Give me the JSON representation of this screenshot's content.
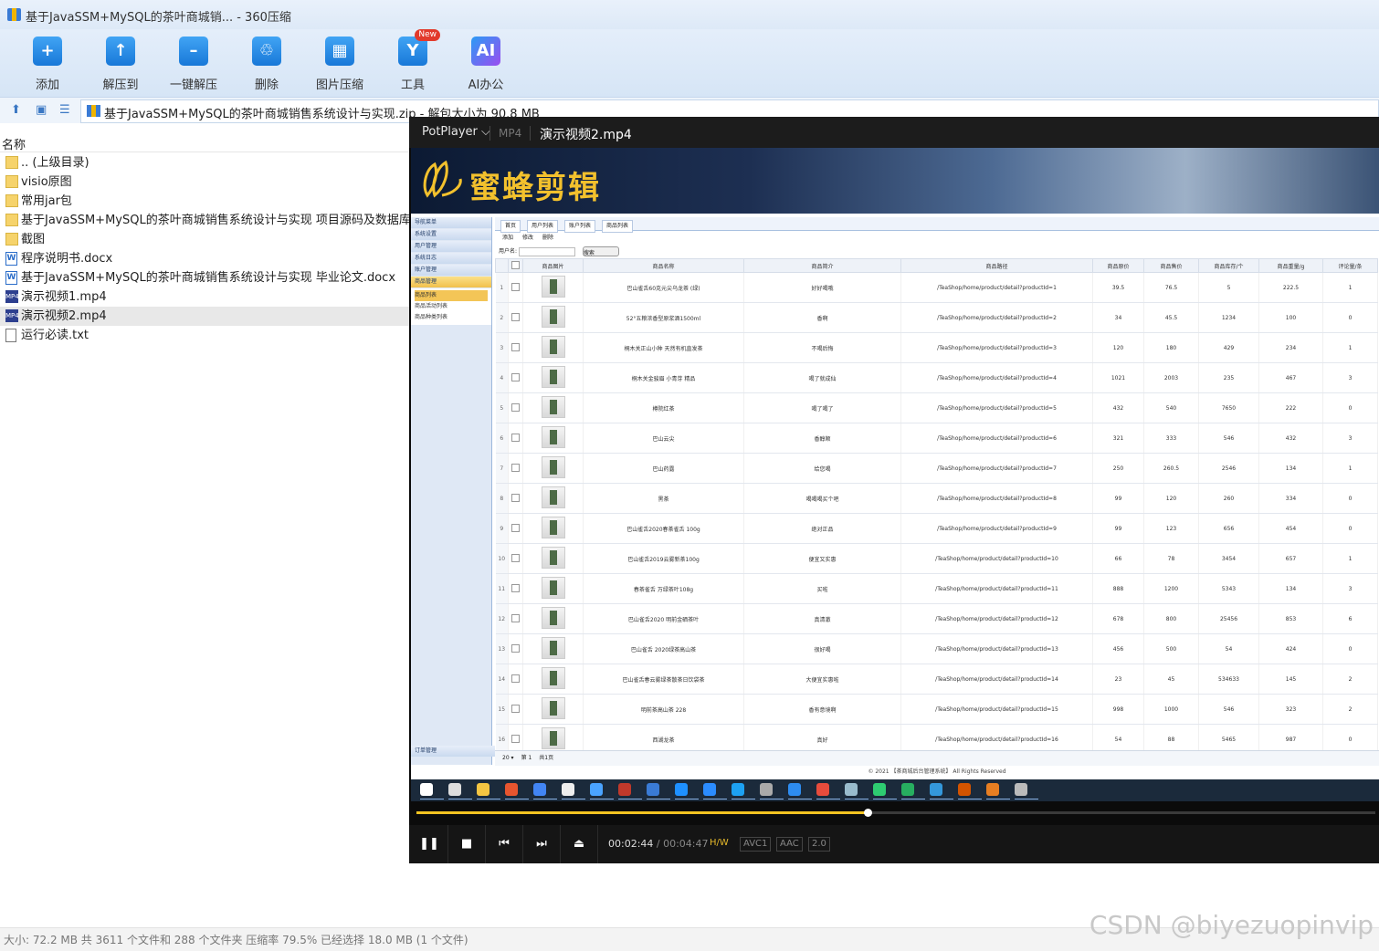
{
  "window": {
    "title": "基于JavaSSM+MySQL的茶叶商城销... - 360压缩"
  },
  "toolbar": [
    {
      "label": "添加",
      "icon": "add-icon",
      "glyph": "+"
    },
    {
      "label": "解压到",
      "icon": "extract-to-icon",
      "glyph": "↑"
    },
    {
      "label": "一键解压",
      "icon": "one-click-extract-icon",
      "glyph": "–"
    },
    {
      "label": "删除",
      "icon": "delete-icon",
      "glyph": "♲"
    },
    {
      "label": "图片压缩",
      "icon": "image-compress-icon",
      "glyph": "▦"
    },
    {
      "label": "工具",
      "icon": "tools-icon",
      "glyph": "Y",
      "badge": "New"
    },
    {
      "label": "AI办公",
      "icon": "ai-office-icon",
      "glyph": "AI"
    }
  ],
  "address": {
    "path": "基于JavaSSM+MySQL的茶叶商城销售系统设计与实现.zip - 解包大小为 90.8 MB"
  },
  "filelist": {
    "column_name": "名称",
    "files": [
      {
        "name": ".. (上级目录)",
        "type": "folder"
      },
      {
        "name": "visio原图",
        "type": "folder"
      },
      {
        "name": "常用jar包",
        "type": "folder"
      },
      {
        "name": "基于JavaSSM+MySQL的茶叶商城销售系统设计与实现 项目源码及数据库文件",
        "type": "folder"
      },
      {
        "name": "截图",
        "type": "folder"
      },
      {
        "name": "程序说明书.docx",
        "type": "docx"
      },
      {
        "name": "基于JavaSSM+MySQL的茶叶商城销售系统设计与实现 毕业论文.docx",
        "type": "docx"
      },
      {
        "name": "演示视频1.mp4",
        "type": "mp4"
      },
      {
        "name": "演示视频2.mp4",
        "type": "mp4",
        "selected": true
      },
      {
        "name": "运行必读.txt",
        "type": "txt"
      }
    ]
  },
  "status": {
    "text": "大小: 72.2 MB 共 3611 个文件和 288 个文件夹 压缩率 79.5% 已经选择 18.0 MB (1 个文件)"
  },
  "watermark": "CSDN @biyezuopinvip",
  "player": {
    "brand": "PotPlayer",
    "format": "MP4",
    "file_title": "演示视频2.mp4",
    "banner_text": "蜜蜂剪辑",
    "current_time": "00:02:44",
    "total_time": "/ 00:04:47",
    "tags": [
      "H/W",
      "AVC1",
      "AAC",
      "2.0"
    ],
    "progress": 0.47
  },
  "admin": {
    "menu": [
      "导航菜单",
      "系统设置",
      "用户管理",
      "系统日志",
      "账户管理",
      "商品管理"
    ],
    "submenu": [
      "商品列表",
      "商品活动列表",
      "商品种类列表"
    ],
    "menu_bottom": "订单管理",
    "tabs": [
      "首页",
      "用户列表",
      "账户列表",
      "商品列表"
    ],
    "ops": [
      "添加",
      "修改",
      "删除"
    ],
    "search_label": "用户名",
    "search_btn": "搜索",
    "columns": [
      "",
      "",
      "商品图片",
      "商品名称",
      "商品简介",
      "商品路径",
      "商品原价",
      "商品售价",
      "商品库存/个",
      "商品重量/g",
      "评论量/条"
    ],
    "rows": [
      [
        "1",
        "巴山雀舌60克元尖乌龙茶 (绿)",
        "好好喝哦",
        "/TeaShop/home/product/detail?productId=1",
        "39.5",
        "76.5",
        "5",
        "222.5",
        "1"
      ],
      [
        "2",
        "52°五粮浓香型原浆酒1500ml",
        "香啊",
        "/TeaShop/home/product/detail?productId=2",
        "34",
        "45.5",
        "1234",
        "100",
        "0"
      ],
      [
        "3",
        "桐木关正山小种 天然有机直发茶",
        "不喝后悔",
        "/TeaShop/home/product/detail?productId=3",
        "120",
        "180",
        "429",
        "234",
        "1"
      ],
      [
        "4",
        "桐木关金骏眉 小青芽 精品",
        "喝了就成仙",
        "/TeaShop/home/product/detail?productId=4",
        "1021",
        "2003",
        "235",
        "467",
        "3"
      ],
      [
        "5",
        "樽院红茶",
        "喝了喝了",
        "/TeaShop/home/product/detail?productId=5",
        "432",
        "540",
        "7650",
        "222",
        "0"
      ],
      [
        "6",
        "巴山云尖",
        "香醇顺",
        "/TeaShop/home/product/detail?productId=6",
        "321",
        "333",
        "546",
        "432",
        "3"
      ],
      [
        "7",
        "巴山药露",
        "给您喝",
        "/TeaShop/home/product/detail?productId=7",
        "250",
        "260.5",
        "2546",
        "134",
        "1"
      ],
      [
        "8",
        "黑茶",
        "喝喝喝买个吧",
        "/TeaShop/home/product/detail?productId=8",
        "99",
        "120",
        "260",
        "334",
        "0"
      ],
      [
        "9",
        "巴山雀舌2020春茶雀舌 100g",
        "绝对正品",
        "/TeaShop/home/product/detail?productId=9",
        "99",
        "123",
        "656",
        "454",
        "0"
      ],
      [
        "10",
        "巴山雀舌2019云雾新茶100g",
        "便宜又实惠",
        "/TeaShop/home/product/detail?productId=10",
        "66",
        "78",
        "3454",
        "657",
        "1"
      ],
      [
        "11",
        "春茶雀舌 万绿茶叶108g",
        "买啦",
        "/TeaShop/home/product/detail?productId=11",
        "888",
        "1200",
        "5343",
        "134",
        "3"
      ],
      [
        "12",
        "巴山雀舌2020 明前金硒茶叶",
        "真清澈",
        "/TeaShop/home/product/detail?productId=12",
        "678",
        "800",
        "25456",
        "853",
        "6"
      ],
      [
        "13",
        "巴山雀舌 2020绿茶高山茶",
        "很好喝",
        "/TeaShop/home/product/detail?productId=13",
        "456",
        "500",
        "54",
        "424",
        "0"
      ],
      [
        "14",
        "巴山雀舌春云雾绿茶散茶日饮袋茶",
        "大便宜实惠啦",
        "/TeaShop/home/product/detail?productId=14",
        "23",
        "45",
        "534633",
        "145",
        "2"
      ],
      [
        "15",
        "明前茶高山茶 228",
        "香有意境啊",
        "/TeaShop/home/product/detail?productId=15",
        "998",
        "1000",
        "546",
        "323",
        "2"
      ],
      [
        "16",
        "西湖龙茶",
        "真好",
        "/TeaShop/home/product/detail?productId=16",
        "54",
        "88",
        "5465",
        "987",
        "0"
      ]
    ],
    "pager": [
      "20 ▾",
      "第 1",
      "共1页"
    ],
    "footer": "© 2021 【茶商城后台管理系统】 All Rights Reserved"
  }
}
